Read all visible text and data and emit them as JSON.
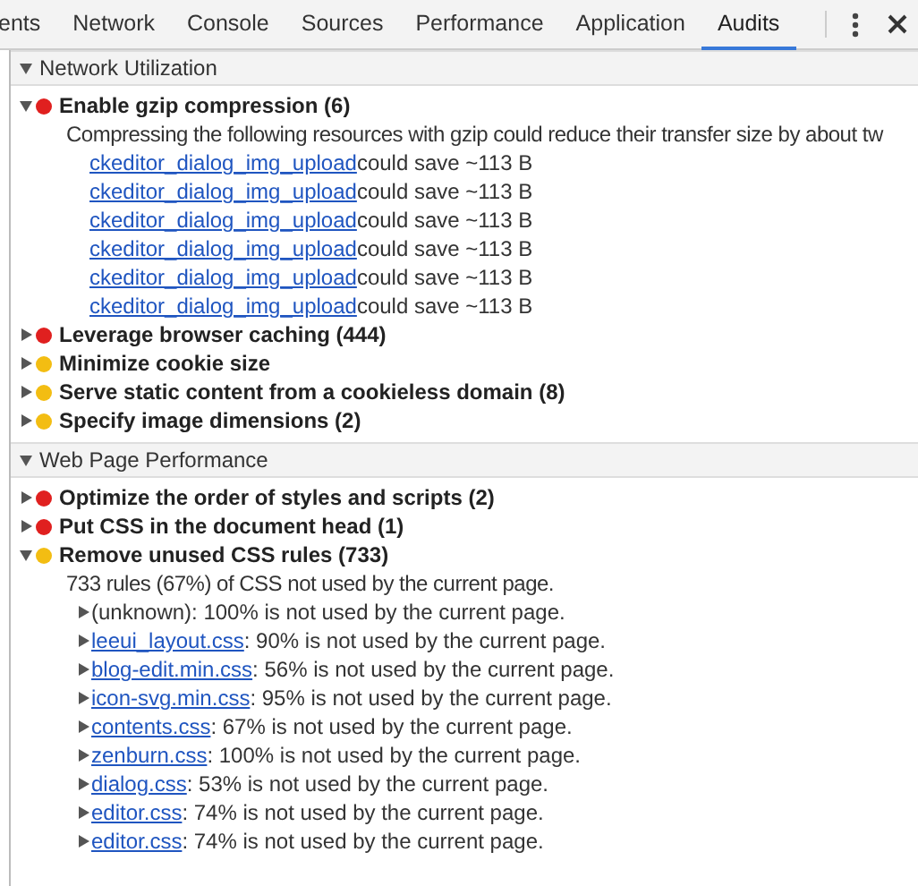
{
  "tabs": [
    {
      "label": "ents",
      "selected": false
    },
    {
      "label": "Network",
      "selected": false
    },
    {
      "label": "Console",
      "selected": false
    },
    {
      "label": "Sources",
      "selected": false
    },
    {
      "label": "Performance",
      "selected": false
    },
    {
      "label": "Application",
      "selected": false
    },
    {
      "label": "Audits",
      "selected": true
    }
  ],
  "sections": [
    {
      "title": "Network Utilization",
      "expanded": true,
      "rules": [
        {
          "title": "Enable gzip compression (6)",
          "color": "#e0201f",
          "expanded": true,
          "description": "Compressing the following resources with gzip could reduce their transfer size by about tw",
          "entries": [
            {
              "link": "ckeditor_dialog_img_upload",
              "text": "could save ~113 B"
            },
            {
              "link": "ckeditor_dialog_img_upload",
              "text": "could save ~113 B"
            },
            {
              "link": "ckeditor_dialog_img_upload",
              "text": "could save ~113 B"
            },
            {
              "link": "ckeditor_dialog_img_upload",
              "text": "could save ~113 B"
            },
            {
              "link": "ckeditor_dialog_img_upload",
              "text": "could save ~113 B"
            },
            {
              "link": "ckeditor_dialog_img_upload",
              "text": "could save ~113 B"
            }
          ]
        },
        {
          "title": "Leverage browser caching (444)",
          "color": "#e0201f",
          "expanded": false
        },
        {
          "title": "Minimize cookie size",
          "color": "#f3bd12",
          "expanded": false
        },
        {
          "title": "Serve static content from a cookieless domain (8)",
          "color": "#f3bd12",
          "expanded": false
        },
        {
          "title": "Specify image dimensions (2)",
          "color": "#f3bd12",
          "expanded": false
        }
      ]
    },
    {
      "title": "Web Page Performance",
      "expanded": true,
      "rules": [
        {
          "title": "Optimize the order of styles and scripts (2)",
          "color": "#e0201f",
          "expanded": false
        },
        {
          "title": "Put CSS in the document head (1)",
          "color": "#e0201f",
          "expanded": false
        },
        {
          "title": "Remove unused CSS rules (733)",
          "color": "#f3bd12",
          "expanded": true,
          "description": "733 rules (67%) of CSS not used by the current page.",
          "entries": [
            {
              "text": "(unknown): 100% is not used by the current page.",
              "expanded": false
            },
            {
              "link": "leeui_layout.css",
              "text": ": 90% is not used by the current page.",
              "expanded": false
            },
            {
              "link": "blog-edit.min.css",
              "text": ": 56% is not used by the current page.",
              "expanded": false
            },
            {
              "link": "icon-svg.min.css",
              "text": ": 95% is not used by the current page.",
              "expanded": false
            },
            {
              "link": "contents.css",
              "text": ": 67% is not used by the current page.",
              "expanded": false
            },
            {
              "link": "zenburn.css",
              "text": ": 100% is not used by the current page.",
              "expanded": false
            },
            {
              "link": "dialog.css",
              "text": ": 53% is not used by the current page.",
              "expanded": false
            },
            {
              "link": "editor.css",
              "text": ": 74% is not used by the current page.",
              "expanded": false
            },
            {
              "link": "editor.css",
              "text": ": 74% is not used by the current page.",
              "expanded": false
            }
          ]
        }
      ]
    }
  ]
}
